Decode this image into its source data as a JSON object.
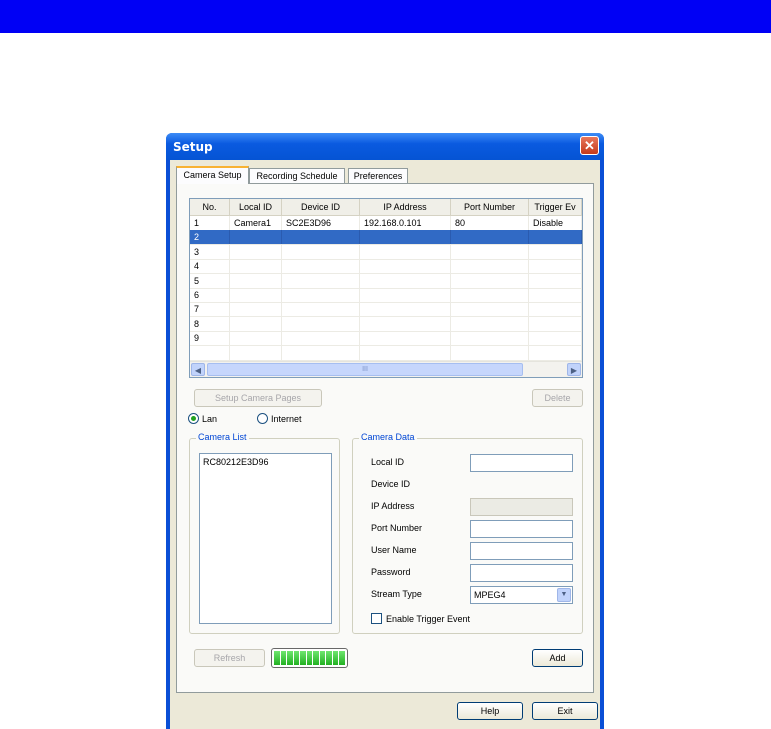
{
  "window": {
    "title": "Setup",
    "close_symbol": "✕"
  },
  "tabs": [
    "Camera Setup",
    "Recording Schedule",
    "Preferences"
  ],
  "grid": {
    "headers": [
      "No.",
      "Local ID",
      "Device ID",
      "IP Address",
      "Port Number",
      "Trigger Ev"
    ],
    "rows": [
      [
        "1",
        "Camera1",
        "SC2E3D96",
        "192.168.0.101",
        "80",
        "Disable"
      ],
      [
        "2",
        "",
        "",
        "",
        "",
        ""
      ],
      [
        "3",
        "",
        "",
        "",
        "",
        ""
      ],
      [
        "4",
        "",
        "",
        "",
        "",
        ""
      ],
      [
        "5",
        "",
        "",
        "",
        "",
        ""
      ],
      [
        "6",
        "",
        "",
        "",
        "",
        ""
      ],
      [
        "7",
        "",
        "",
        "",
        "",
        ""
      ],
      [
        "8",
        "",
        "",
        "",
        "",
        ""
      ],
      [
        "9",
        "",
        "",
        "",
        "",
        ""
      ],
      [
        "",
        "",
        "",
        "",
        "",
        ""
      ]
    ],
    "selected_row": 2,
    "scroll_left": "◀",
    "scroll_right": "▶",
    "scroll_grip": "III"
  },
  "buttons": {
    "setup_camera_pages": "Setup Camera Pages",
    "delete": "Delete",
    "refresh": "Refresh",
    "add": "Add",
    "help": "Help",
    "exit": "Exit"
  },
  "network": {
    "lan": "Lan",
    "internet": "Internet",
    "selected": "Lan"
  },
  "camera_list": {
    "label": "Camera List",
    "items": [
      "RC80212E3D96"
    ]
  },
  "camera_data": {
    "label": "Camera Data",
    "local_id": "Local ID",
    "device_id": "Device ID",
    "ip_address": "IP Address",
    "port_number": "Port Number",
    "user_name": "User Name",
    "password": "Password",
    "stream_type": "Stream Type",
    "stream_type_value": "MPEG4",
    "enable_trigger": "Enable Trigger Event",
    "enable_trigger_checked": false
  },
  "progress": {
    "filled_blocks": 11,
    "fraction": 1.0
  },
  "colors": {
    "selection": "#316ac5",
    "titlebar": "#0a5ae0",
    "topbar": "#0000f5"
  }
}
